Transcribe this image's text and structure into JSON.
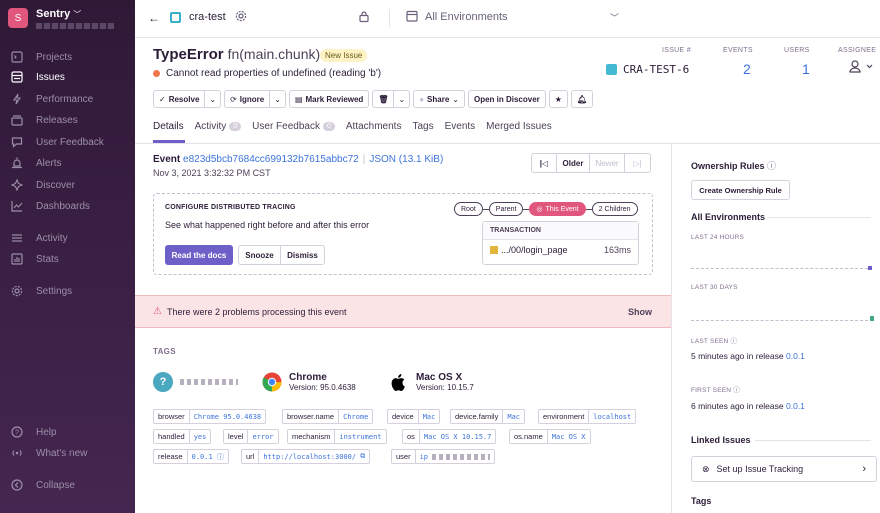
{
  "sidebar": {
    "org_initial": "S",
    "org_name": "Sentry",
    "org_chevron": "﹀",
    "nav": [
      {
        "label": "Projects",
        "icon": "projects-icon"
      },
      {
        "label": "Issues",
        "icon": "issues-icon"
      },
      {
        "label": "Performance",
        "icon": "performance-icon"
      },
      {
        "label": "Releases",
        "icon": "releases-icon"
      },
      {
        "label": "User Feedback",
        "icon": "feedback-icon"
      },
      {
        "label": "Alerts",
        "icon": "alerts-icon"
      },
      {
        "label": "Discover",
        "icon": "discover-icon"
      },
      {
        "label": "Dashboards",
        "icon": "dashboards-icon"
      },
      {
        "label": "Activity",
        "icon": "activity-icon"
      },
      {
        "label": "Stats",
        "icon": "stats-icon"
      },
      {
        "label": "Settings",
        "icon": "settings-icon"
      }
    ],
    "footer": [
      {
        "label": "Help",
        "icon": "help-icon"
      },
      {
        "label": "What's new",
        "icon": "broadcast-icon"
      },
      {
        "label": "Collapse",
        "icon": "collapse-icon"
      }
    ],
    "active": "Issues",
    "accent": "#e1567c"
  },
  "topbar": {
    "project": "cra-test",
    "environment": "All Environments"
  },
  "issue": {
    "type": "TypeError",
    "function": "fn(main.chunk)",
    "badge": "New Issue",
    "message": "Cannot read properties of undefined (reading 'b')",
    "issue_label": "ISSUE #",
    "issue_id": "CRA-TEST-6",
    "events_label": "EVENTS",
    "events": "2",
    "users_label": "USERS",
    "users": "1",
    "assignee_label": "ASSIGNEE"
  },
  "actions": {
    "resolve": "Resolve",
    "ignore": "Ignore",
    "mark_reviewed": "Mark Reviewed",
    "share": "Share",
    "open_discover": "Open in Discover"
  },
  "tabs": [
    {
      "label": "Details"
    },
    {
      "label": "Activity",
      "count": "0"
    },
    {
      "label": "User Feedback",
      "count": "0"
    },
    {
      "label": "Attachments"
    },
    {
      "label": "Tags"
    },
    {
      "label": "Events"
    },
    {
      "label": "Merged Issues"
    }
  ],
  "event": {
    "label": "Event",
    "hash": "e823d5bcb7684cc699132b7615abbc72",
    "json": "JSON (13.1 KiB)",
    "date": "Nov 3, 2021 3:32:32 PM CST",
    "older": "Older",
    "newer": "Newer"
  },
  "tracing": {
    "title": "CONFIGURE DISTRIBUTED TRACING",
    "desc": "See what happened right before and after this error",
    "docs": "Read the docs",
    "snooze": "Snooze",
    "dismiss": "Dismiss",
    "chain": [
      "Root",
      "Parent",
      "This Event",
      "2 Children"
    ],
    "transaction_label": "TRANSACTION",
    "transaction_name": ".../00/login_page",
    "transaction_duration": "163ms"
  },
  "problems": {
    "text": "There were 2 problems processing this event",
    "show": "Show"
  },
  "tags": {
    "title": "TAGS",
    "browser_name": "Chrome",
    "browser_version": "Version: 95.0.4638",
    "os_name": "Mac OS X",
    "os_version": "Version: 10.15.7",
    "pills": [
      {
        "k": "browser",
        "v": "Chrome 95.0.4638"
      },
      {
        "k": "browser.name",
        "v": "Chrome"
      },
      {
        "k": "device",
        "v": "Mac"
      },
      {
        "k": "device.family",
        "v": "Mac"
      },
      {
        "k": "environment",
        "v": "localhost"
      },
      {
        "k": "handled",
        "v": "yes"
      },
      {
        "k": "level",
        "v": "error"
      },
      {
        "k": "mechanism",
        "v": "instrument"
      },
      {
        "k": "os",
        "v": "Mac OS X 10.15.7"
      },
      {
        "k": "os.name",
        "v": "Mac OS X"
      },
      {
        "k": "release",
        "v": "0.0.1"
      },
      {
        "k": "url",
        "v": "http://localhost:3000/"
      },
      {
        "k": "user",
        "v": "ip"
      }
    ]
  },
  "right": {
    "ownership": "Ownership Rules",
    "create_rule": "Create Ownership Rule",
    "all_envs": "All Environments",
    "last24": "LAST 24 HOURS",
    "last30": "LAST 30 DAYS",
    "last_seen_label": "LAST SEEN",
    "last_seen": "5 minutes ago in release",
    "first_seen_label": "FIRST SEEN",
    "first_seen": "6 minutes ago in release",
    "release": "0.0.1",
    "linked": "Linked Issues",
    "tracking": "Set up Issue Tracking",
    "tags": "Tags"
  }
}
